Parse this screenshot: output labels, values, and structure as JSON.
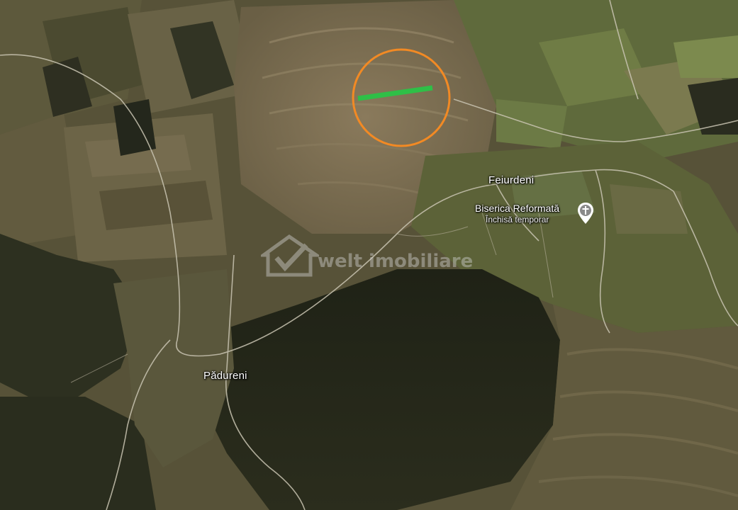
{
  "map": {
    "view": "satellite",
    "marker_circle_color": "#f28a24",
    "marker_line_color": "#2fbf47",
    "poi_pin_color": "#ffffff",
    "poi_pin_icon": "cross-icon"
  },
  "places": {
    "feiurdeni": "Feiurdeni",
    "padureni": "Pădureni"
  },
  "poi": {
    "name": "Biserica Reformată",
    "status": "Închisă temporar"
  },
  "watermark": {
    "text": "welt imobiliare",
    "logo_icon": "house-check-icon"
  }
}
